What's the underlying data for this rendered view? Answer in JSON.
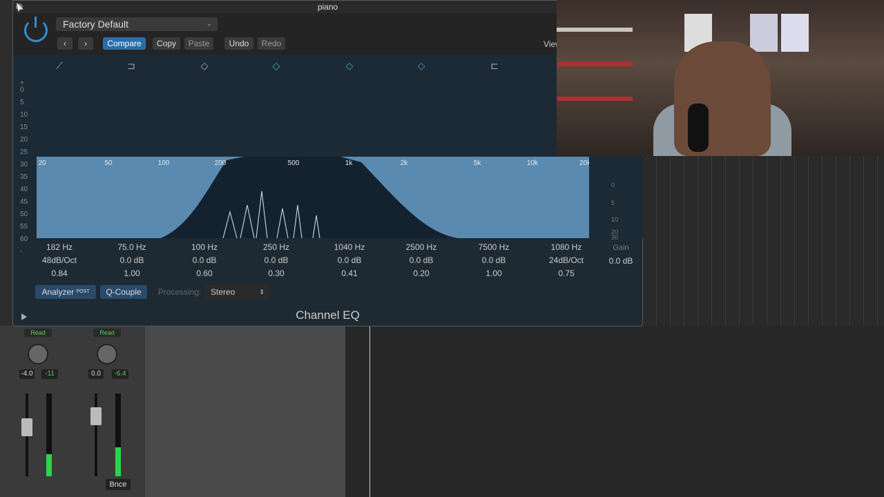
{
  "window": {
    "title": "piano"
  },
  "header": {
    "preset": "Factory Default",
    "buttons": {
      "compare": "Compare",
      "copy": "Copy",
      "paste": "Paste",
      "undo": "Undo",
      "redo": "Redo"
    },
    "view_label": "View"
  },
  "eq": {
    "db_scale": [
      "+",
      "0",
      "5",
      "10",
      "15",
      "20",
      "25",
      "30",
      "35",
      "40",
      "45",
      "50",
      "55",
      "60",
      "-"
    ],
    "freq_labels": [
      "20",
      "50",
      "100",
      "200",
      "500",
      "1k",
      "2k",
      "5k",
      "10k",
      "20k"
    ],
    "gain_scale": [
      "0",
      "5",
      "10",
      "20",
      "30"
    ],
    "bands": [
      {
        "freq": "182 Hz",
        "gain": "48dB/Oct",
        "q": "0.84"
      },
      {
        "freq": "75.0 Hz",
        "gain": "0.0 dB",
        "q": "1.00"
      },
      {
        "freq": "100 Hz",
        "gain": "0.0 dB",
        "q": "0.60"
      },
      {
        "freq": "250 Hz",
        "gain": "0.0 dB",
        "q": "0.30"
      },
      {
        "freq": "1040 Hz",
        "gain": "0.0 dB",
        "q": "0.41"
      },
      {
        "freq": "2500 Hz",
        "gain": "0.0 dB",
        "q": "0.20"
      },
      {
        "freq": "7500 Hz",
        "gain": "0.0 dB",
        "q": "1.00"
      },
      {
        "freq": "1080 Hz",
        "gain": "24dB/Oct",
        "q": "0.75"
      }
    ],
    "gain": {
      "label": "Gain",
      "value": "0.0 dB"
    }
  },
  "footer": {
    "analyzer": "Analyzer",
    "analyzer_mode": "POST",
    "q_couple": "Q-Couple",
    "processing_label": "Processing:",
    "processing_value": "Stereo"
  },
  "plugin_name": "Channel EQ",
  "mixer": {
    "strips": [
      {
        "automation": "Read",
        "vol": "-4.0",
        "peak": "-11"
      },
      {
        "automation": "Read",
        "vol": "0.0",
        "peak": "-6.4"
      }
    ],
    "bnce": "Bnce"
  },
  "colors": {
    "accent": "#2a6ea8",
    "eq_fill": "#5a8ab0",
    "meter": "#2bd44a"
  }
}
